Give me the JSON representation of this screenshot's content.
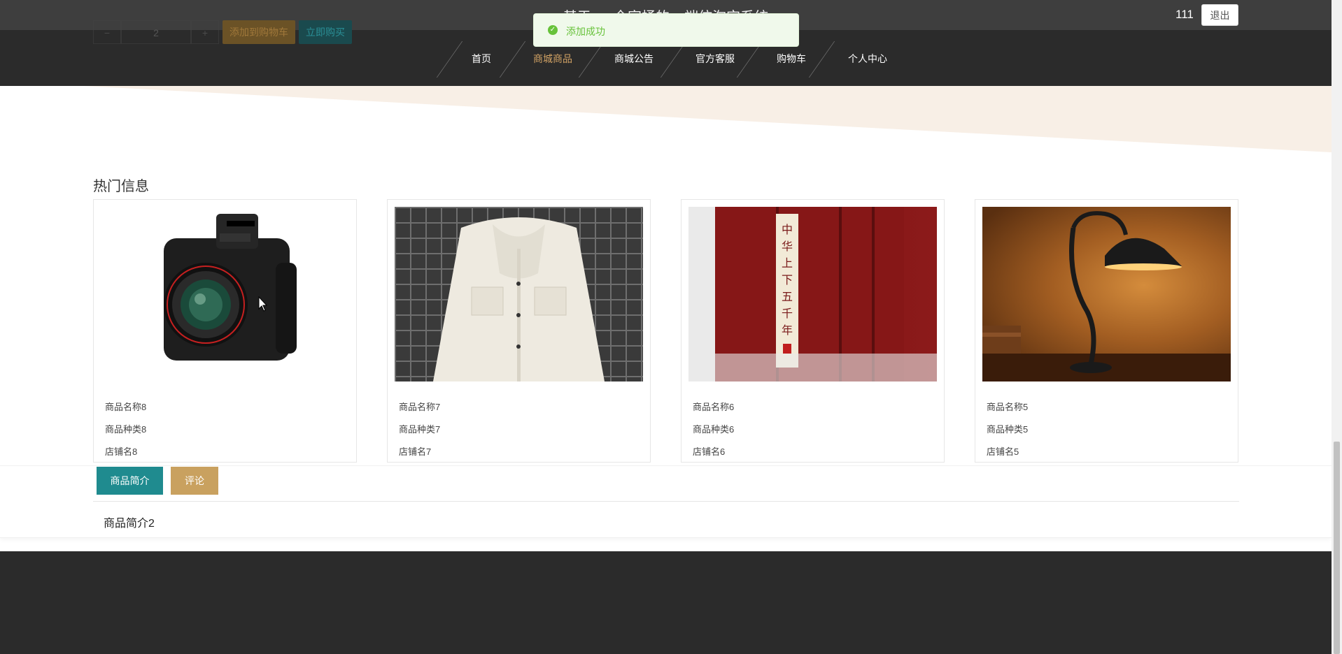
{
  "header": {
    "site_title": "基于vue全家桶的pc端仿淘宝系统",
    "username": "111",
    "logout_label": "退出"
  },
  "nav": {
    "items": [
      {
        "label": "首页",
        "active": false
      },
      {
        "label": "商城商品",
        "active": true
      },
      {
        "label": "商城公告",
        "active": false
      },
      {
        "label": "官方客服",
        "active": false
      },
      {
        "label": "购物车",
        "active": false
      },
      {
        "label": "个人中心",
        "active": false
      }
    ]
  },
  "purchase": {
    "minus": "−",
    "quantity": "2",
    "plus": "+",
    "add_to_cart": "添加到购物车",
    "buy_now": "立即购买"
  },
  "toast": {
    "message": "添加成功",
    "icon": "success-check-icon"
  },
  "hot": {
    "title": "热门信息",
    "cards": [
      {
        "name": "商品名称8",
        "category": "商品种类8",
        "shop": "店铺名8",
        "image": "camera"
      },
      {
        "name": "商品名称7",
        "category": "商品种类7",
        "shop": "店铺名7",
        "image": "jacket"
      },
      {
        "name": "商品名称6",
        "category": "商品种类6",
        "shop": "店铺名6",
        "image": "books"
      },
      {
        "name": "商品名称5",
        "category": "商品种类5",
        "shop": "店铺名5",
        "image": "lamp"
      }
    ]
  },
  "tabs": {
    "intro_label": "商品简介",
    "comment_label": "评论",
    "intro_text": "商品简介2"
  },
  "book_spine_chars": "中华上下五千年",
  "colors": {
    "topbar": "#3e3e3e",
    "navbar": "#2b2b2b",
    "accent_gold": "#d1a264",
    "tab_teal": "#1f8b8f",
    "tab_gold": "#c9a15f",
    "toast_green": "#67c23a",
    "beige": "#f8efe6"
  }
}
